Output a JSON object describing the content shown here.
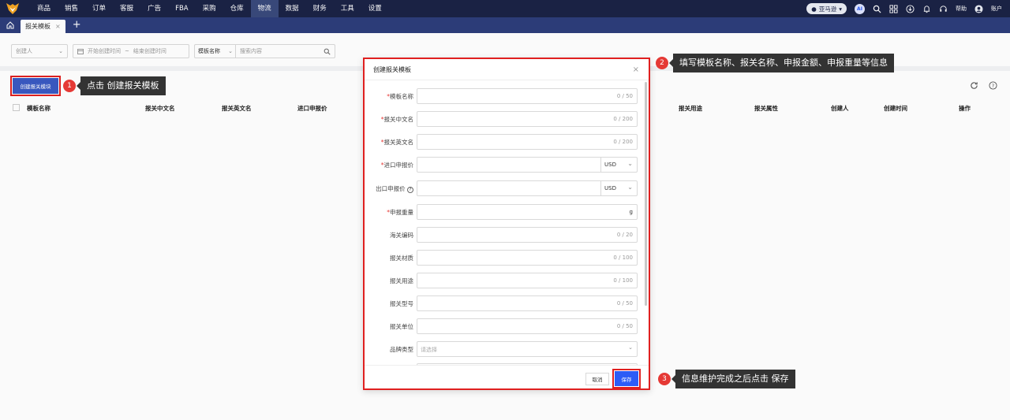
{
  "topnav": {
    "items": [
      "商品",
      "销售",
      "订单",
      "客服",
      "广告",
      "FBA",
      "采购",
      "仓库",
      "物流",
      "数据",
      "财务",
      "工具",
      "设置"
    ],
    "active_index": 8,
    "store": "亚马逊",
    "ai_label": "AI",
    "help": "帮助",
    "account": "账户"
  },
  "tabs": {
    "current": "报关模板",
    "close": "×",
    "add": "+"
  },
  "filters": {
    "creator_placeholder": "创建人",
    "date_start": "开始创建时间",
    "date_sep": "~",
    "date_end": "结束创建时间",
    "field_select": "模板名称",
    "search_placeholder": "搜索内容"
  },
  "toolbar": {
    "create_label": "创建报关模块"
  },
  "table": {
    "columns": [
      "模板名称",
      "报关中文名",
      "报关英文名",
      "进口申报价",
      "报关用途",
      "报关属性",
      "创建人",
      "创建时间",
      "操作"
    ]
  },
  "modal": {
    "title": "创建报关模板",
    "close": "×",
    "fields": [
      {
        "required": true,
        "label": "模板名称",
        "counter": "0 / 50"
      },
      {
        "required": true,
        "label": "报关中文名",
        "counter": "0 / 200"
      },
      {
        "required": true,
        "label": "报关英文名",
        "counter": "0 / 200"
      },
      {
        "required": true,
        "label": "进口申报价",
        "currency": "USD"
      },
      {
        "required": false,
        "label": "出口申报价",
        "currency": "USD",
        "info": "?"
      },
      {
        "required": true,
        "label": "申报重量",
        "unit": "g"
      },
      {
        "required": false,
        "label": "海关编码",
        "counter": "0 / 20"
      },
      {
        "required": false,
        "label": "报关材质",
        "counter": "0 / 100"
      },
      {
        "required": false,
        "label": "报关用途",
        "counter": "0 / 100"
      },
      {
        "required": false,
        "label": "报关型号",
        "counter": "0 / 50"
      },
      {
        "required": false,
        "label": "报关单位",
        "counter": "0 / 50"
      },
      {
        "required": false,
        "label": "品牌类型",
        "placeholder": "请选择"
      }
    ],
    "cancel": "取消",
    "save": "保存"
  },
  "steps": [
    {
      "num": "1",
      "text": "点击 创建报关模板"
    },
    {
      "num": "2",
      "text": "填写模板名称、报关名称、申报金额、申报重量等信息"
    },
    {
      "num": "3",
      "text": "信息维护完成之后点击 保存"
    }
  ],
  "colors": {
    "nav_bg": "#1b2346",
    "tab_bg": "#2d3e7b",
    "primary": "#2d5cf6",
    "highlight": "#e02020"
  }
}
